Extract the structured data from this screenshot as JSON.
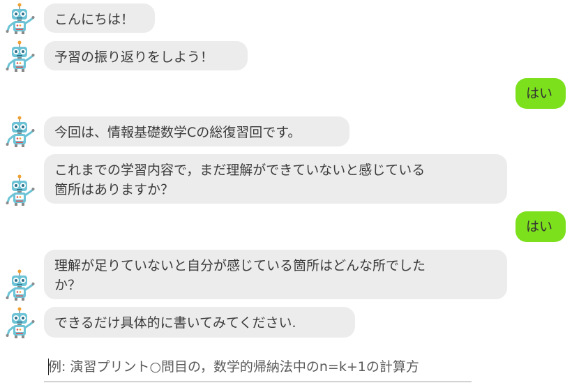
{
  "messages": [
    {
      "sender": "bot",
      "text": "こんにちは！"
    },
    {
      "sender": "bot",
      "text": "予習の振り返りをしよう！"
    },
    {
      "sender": "user",
      "text": "はい"
    },
    {
      "sender": "bot",
      "text": "今回は、情報基礎数学Cの総復習回です。"
    },
    {
      "sender": "bot",
      "text": "これまでの学習内容で，まだ理解ができていないと感じている\n箇所はありますか？"
    },
    {
      "sender": "user",
      "text": "はい"
    },
    {
      "sender": "bot",
      "text": "理解が足りていないと自分が感じている箇所はどんな所でした\nか？"
    },
    {
      "sender": "bot",
      "text": "できるだけ具体的に書いてみてください."
    }
  ],
  "input": {
    "value": "",
    "placeholder": "例: 演習プリント○問目の，数学的帰納法中のn=k+1の計算方"
  },
  "colors": {
    "bot_bubble": "#ececec",
    "user_bubble": "#7ce01c",
    "robot_body": "#6cc3d6",
    "robot_antenna": "#f0a030"
  },
  "icons": {
    "bot_avatar": "robot-icon"
  }
}
